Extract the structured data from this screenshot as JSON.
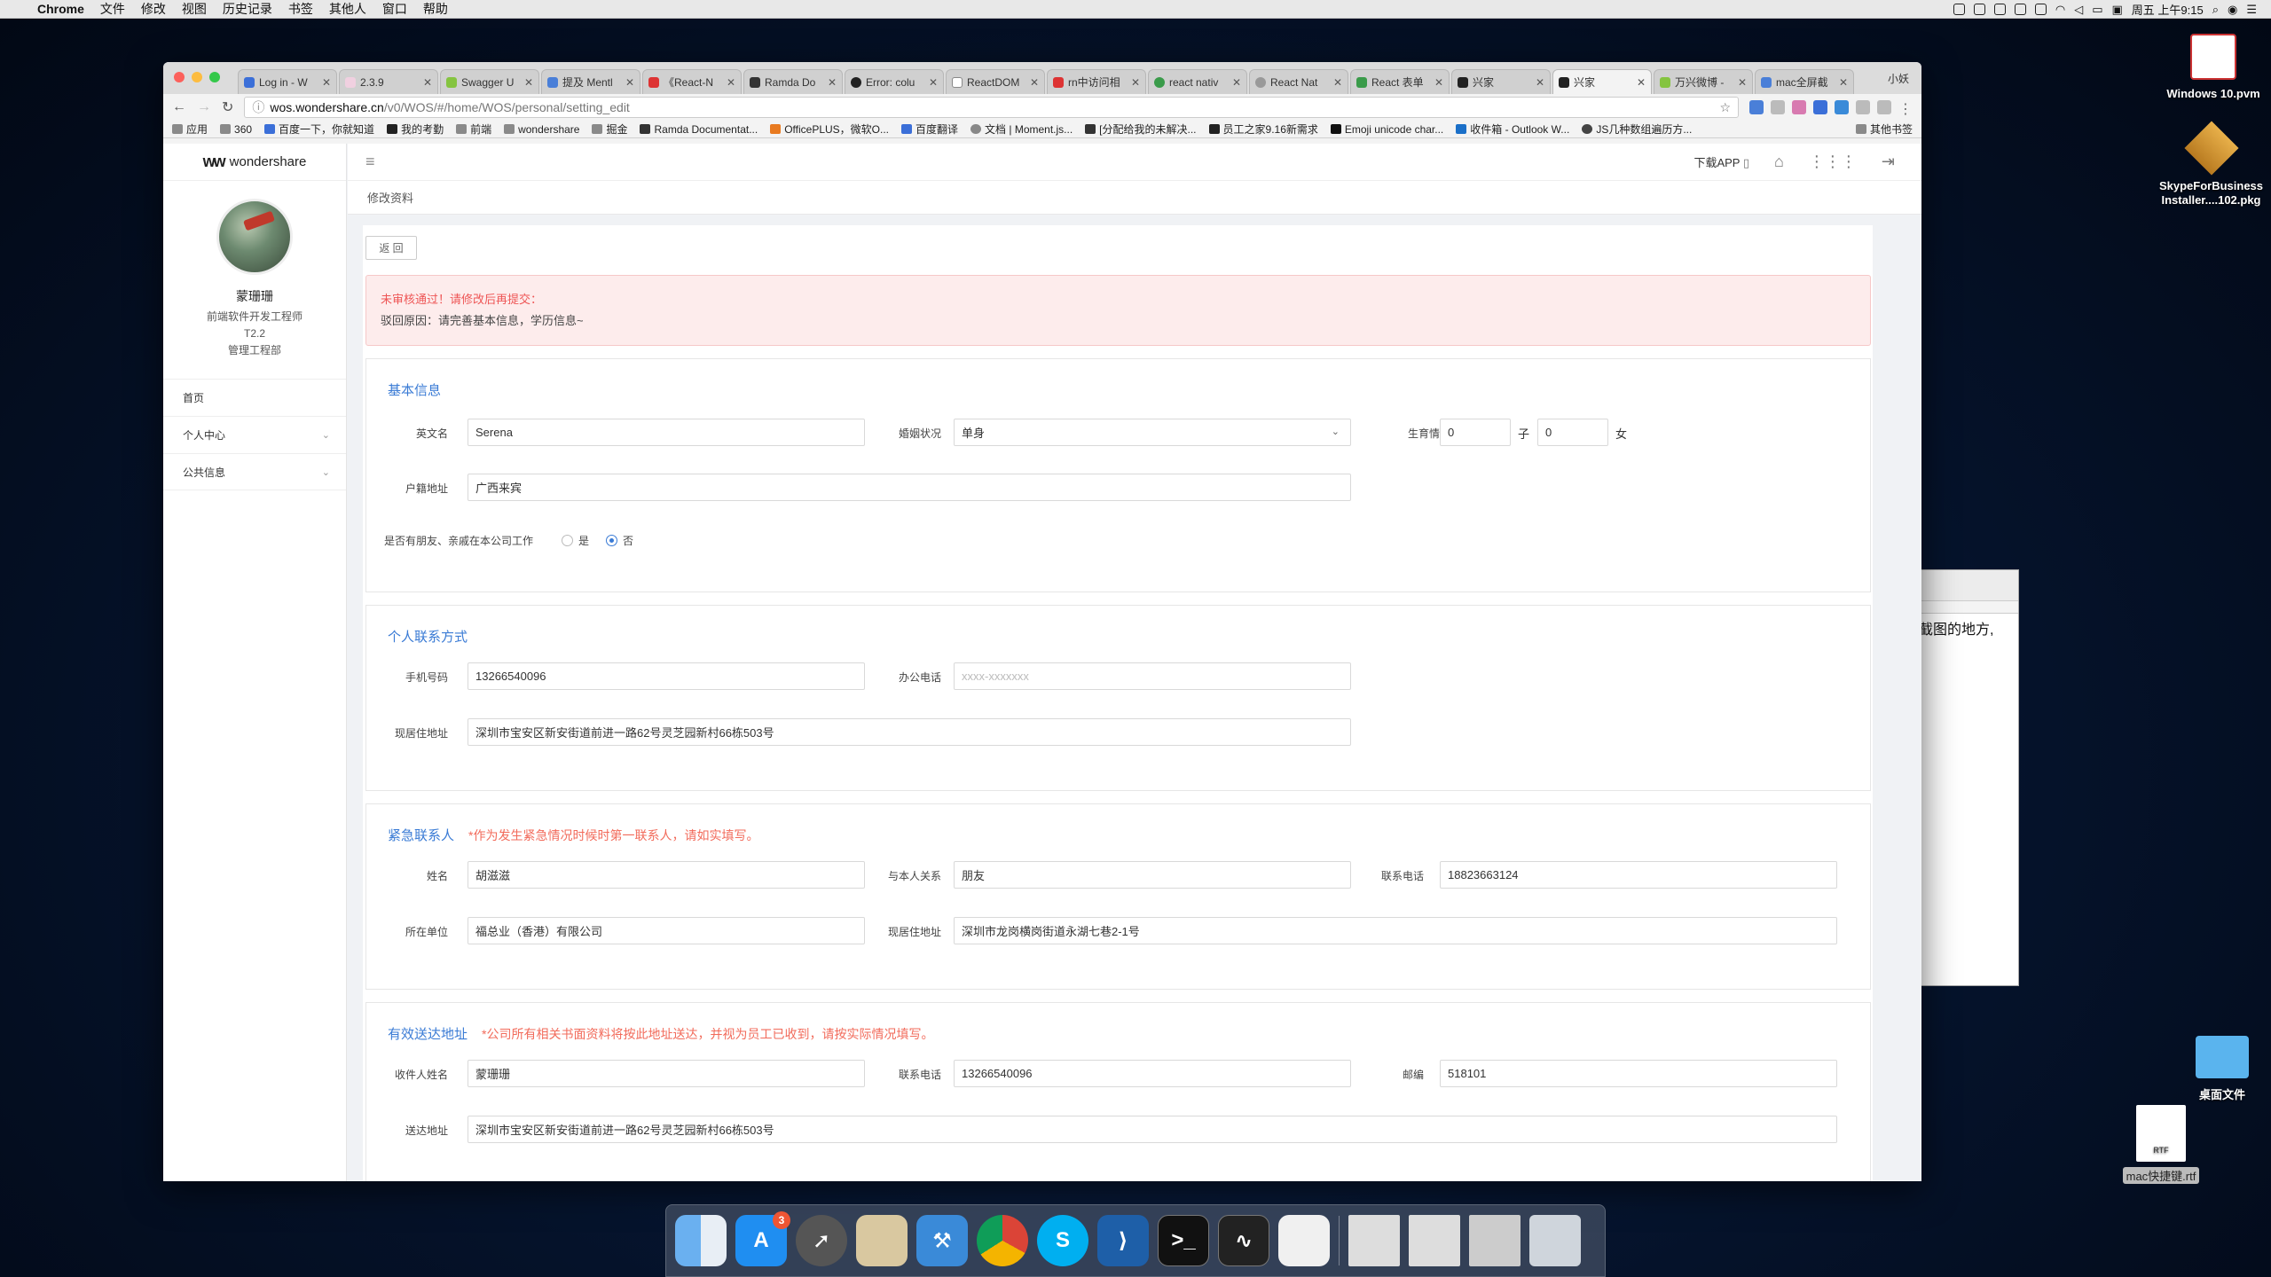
{
  "menubar": {
    "app": "Chrome",
    "items": [
      "文件",
      "修改",
      "视图",
      "历史记录",
      "书签",
      "其他人",
      "窗口",
      "帮助"
    ],
    "clock": "周五 上午9:15"
  },
  "desktop": {
    "items": [
      {
        "label": "Windows 10.pvm"
      },
      {
        "label": "SkypeForBusiness Installer....102.pkg"
      },
      {
        "label": "桌面文件"
      },
      {
        "label": "mac快捷键.rtf"
      }
    ],
    "bgwin_text": "截图的地方,"
  },
  "browser": {
    "tabs": [
      {
        "label": "Log in - W"
      },
      {
        "label": "2.3.9"
      },
      {
        "label": "Swagger U"
      },
      {
        "label": "提及 Mentl"
      },
      {
        "label": "《React-N"
      },
      {
        "label": "Ramda Do"
      },
      {
        "label": "Error: colu"
      },
      {
        "label": "ReactDOM"
      },
      {
        "label": "rn中访问相"
      },
      {
        "label": "react nativ"
      },
      {
        "label": "React Nat"
      },
      {
        "label": "React 表单"
      },
      {
        "label": "兴家"
      },
      {
        "label": "兴家"
      },
      {
        "label": "万兴微博 -"
      },
      {
        "label": "mac全屏截"
      }
    ],
    "profile": "小妖",
    "url_host": "wos.wondershare.cn",
    "url_path": "/v0/WOS/#/home/WOS/personal/setting_edit",
    "bookmarks": [
      "应用",
      "360",
      "百度一下，你就知道",
      "我的考勤",
      "前端",
      "wondershare",
      "掘金",
      "Ramda Documentat...",
      "OfficePLUS，微软O...",
      "百度翻译",
      "文档 | Moment.js...",
      "[分配给我的未解决...",
      "员工之家9.16新需求",
      "Emoji unicode char...",
      "收件箱 - Outlook W...",
      "JS几种数组遍历方...",
      "其他书签"
    ]
  },
  "app": {
    "logo": "wondershare",
    "user": {
      "name": "蒙珊珊",
      "title": "前端软件开发工程师",
      "level": "T2.2",
      "dept": "管理工程部"
    },
    "nav": [
      {
        "label": "首页"
      },
      {
        "label": "个人中心"
      },
      {
        "label": "公共信息"
      }
    ],
    "topbar": {
      "download": "下载APP"
    },
    "breadcrumb": "修改资料",
    "back_button": "返 回",
    "alert": {
      "title": "未审核通过！请修改后再提交：",
      "reason": "驳回原因：请完善基本信息，学历信息~"
    },
    "basic": {
      "title": "基本信息",
      "english_name_label": "英文名",
      "english_name": "Serena",
      "marital_label": "婚姻状况",
      "marital": "单身",
      "children_label": "生育情况",
      "sons": "0",
      "son_suffix": "子",
      "daughters": "0",
      "daughter_suffix": "女",
      "hukou_label": "户籍地址",
      "hukou": "广西来宾",
      "relatives_label": "是否有朋友、亲戚在本公司工作",
      "yes": "是",
      "no": "否"
    },
    "contact": {
      "title": "个人联系方式",
      "mobile_label": "手机号码",
      "mobile": "13266540096",
      "office_label": "办公电话",
      "office_placeholder": "xxxx-xxxxxxx",
      "address_label": "现居住地址",
      "address": "深圳市宝安区新安街道前进一路62号灵芝园新村66栋503号"
    },
    "emergency": {
      "title": "紧急联系人",
      "note": "*作为发生紧急情况时候时第一联系人，请如实填写。",
      "name_label": "姓名",
      "name": "胡滋滋",
      "relation_label": "与本人关系",
      "relation": "朋友",
      "phone_label": "联系电话",
      "phone": "18823663124",
      "company_label": "所在单位",
      "company": "福总业（香港）有限公司",
      "address_label": "现居住地址",
      "address": "深圳市龙岗横岗街道永湖七巷2-1号"
    },
    "delivery": {
      "title": "有效送达地址",
      "note": "*公司所有相关书面资料将按此地址送达，并视为员工已收到，请按实际情况填写。",
      "receiver_label": "收件人姓名",
      "receiver": "蒙珊珊",
      "phone_label": "联系电话",
      "phone": "13266540096",
      "zip_label": "邮编",
      "zip": "518101",
      "address_label": "送达地址",
      "address": "深圳市宝安区新安街道前进一路62号灵芝园新村66栋503号"
    }
  },
  "dock": {
    "appstore_badge": "3"
  }
}
